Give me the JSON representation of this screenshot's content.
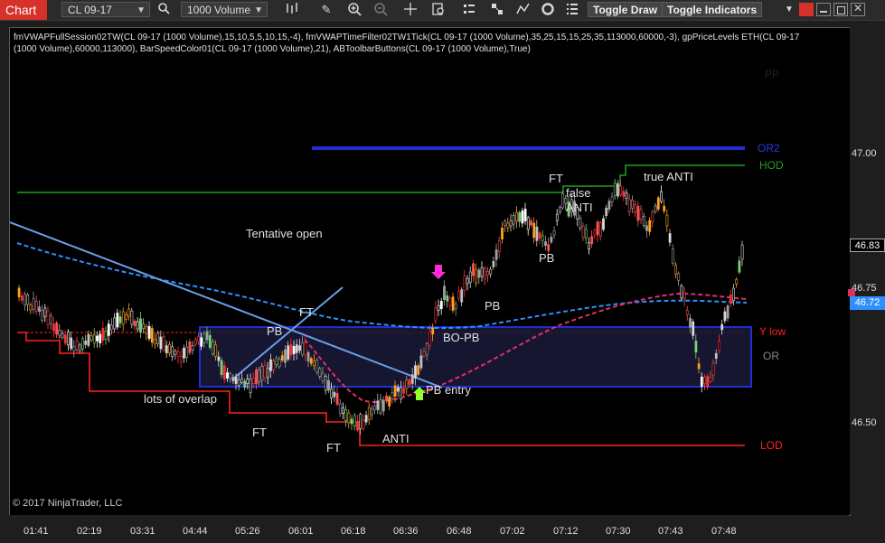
{
  "toolbar": {
    "chart_tab": "Chart",
    "instrument": "CL 09-17",
    "period": "1000 Volume",
    "toggle_draw": "Toggle Draw",
    "toggle_indicators": "Toggle Indicators"
  },
  "chart": {
    "indicator_line1": "fmVWAPFullSession02TW(CL 09-17 (1000 Volume),15,10,5,5,10,15,-4), fmVWAPTimeFilter02TW1Tick(CL 09-17 (1000 Volume),35,25,15,15,25,35,113000,60000,-3), gpPriceLevels ETH(CL 09-17",
    "indicator_line2": "(1000 Volume),60000,113000), BarSpeedColor01(CL 09-17 (1000 Volume),21), ABToolbarButtons(CL 09-17 (1000 Volume),True)",
    "copyright": "© 2017 NinjaTrader, LLC",
    "annotations": {
      "tentative_open": "Tentative open",
      "lots_of_overlap": "lots of overlap",
      "ft_1": "FT",
      "ft_2": "FT",
      "ft_3": "FT",
      "ft_4": "FT",
      "pb_1": "PB",
      "pb_2": "PB",
      "pb_3": "PB",
      "bo_pb": "BO-PB",
      "pb_entry": "PB entry",
      "anti": "ANTI",
      "false_anti": "false\nANTI",
      "true_anti": "true ANTI"
    },
    "level_labels": {
      "pp": "PP",
      "or2": "OR2",
      "hod": "HOD",
      "y_low": "Y low",
      "or": "OR",
      "lod": "LOD"
    },
    "level_colors": {
      "pp": "#000000",
      "or2": "#1f2fd0",
      "hod": "#1fa01f",
      "y_low": "#ff2020",
      "or": "#888888",
      "lod": "#ff2020"
    }
  },
  "price_axis": {
    "ticks": [
      "47.00",
      "46.75",
      "46.50"
    ],
    "last_price": "46.83",
    "vwap_price": "46.72"
  },
  "time_axis": {
    "ticks": [
      "01:41",
      "02:19",
      "03:31",
      "04:44",
      "05:26",
      "06:01",
      "06:18",
      "06:36",
      "06:48",
      "07:02",
      "07:12",
      "07:30",
      "07:43",
      "07:48"
    ]
  }
}
